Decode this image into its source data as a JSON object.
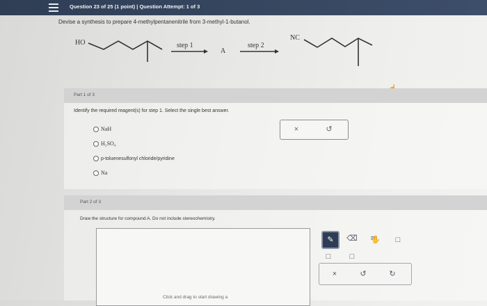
{
  "header": {
    "question_status": "Question 23 of 25 (1 point)  |  Question Attempt: 1 of 3"
  },
  "prompt": "Devise a synthesis to prepare 4-methylpentanenitrile from 3-methyl-1-butanol.",
  "scheme": {
    "start_group": "HO",
    "step1_label": "step 1",
    "intermediate": "A",
    "step2_label": "step 2",
    "product_group": "NC"
  },
  "part1": {
    "label": "Part 1 of 3",
    "instruction": "Identify the required reagent(s) for step 1. Select the single best answer.",
    "options": [
      {
        "label": "NaH"
      },
      {
        "label": "H₂SO₄"
      },
      {
        "label": "p-toluenesulfonyl chloride/pyridine"
      },
      {
        "label": "Na"
      }
    ],
    "buttons": {
      "clear": "×",
      "undo": "↺"
    }
  },
  "part2": {
    "label": "Part 2 of 3",
    "instruction": "Draw the structure for compound A. Do not include stereochemistry.",
    "canvas_hint": "Click and drag to start drawing a"
  },
  "toolbar": {
    "clear": "×",
    "undo": "↺",
    "redo": "↻"
  }
}
